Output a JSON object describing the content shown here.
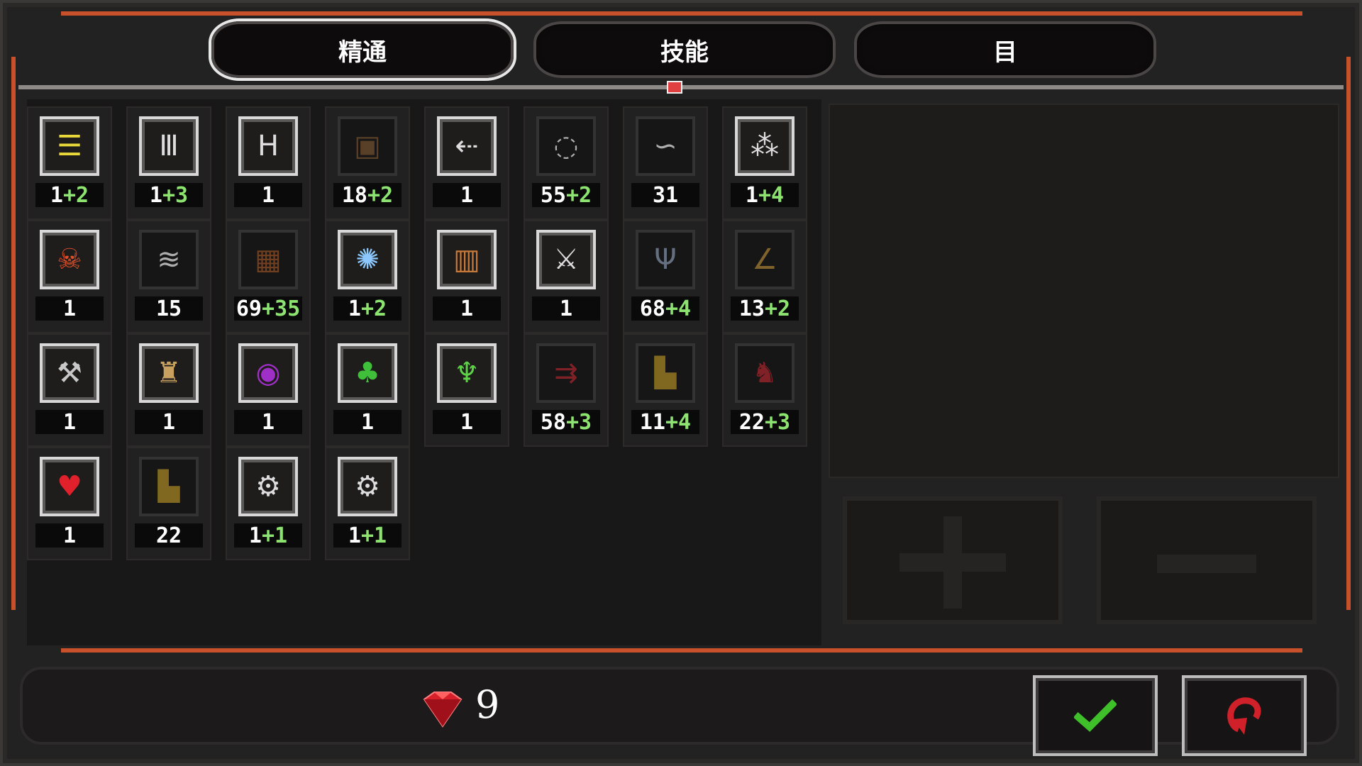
{
  "tabs": [
    {
      "label": "精通",
      "active": true
    },
    {
      "label": "技能",
      "active": false
    },
    {
      "label": "目",
      "active": false
    }
  ],
  "mastery_grid": [
    [
      {
        "icon": "bolts-icon",
        "base": "1",
        "bonus": "+2",
        "lit": true
      },
      {
        "icon": "spikes-icon",
        "base": "1",
        "bonus": "+3",
        "lit": true
      },
      {
        "icon": "ladder-icon",
        "base": "1",
        "bonus": "",
        "lit": true
      },
      {
        "icon": "crate-icon",
        "base": "18",
        "bonus": "+2",
        "lit": false
      },
      {
        "icon": "arrow-trail-icon",
        "base": "1",
        "bonus": "",
        "lit": true
      },
      {
        "icon": "dashed-ring-icon",
        "base": "55",
        "bonus": "+2",
        "lit": false
      },
      {
        "icon": "rope-icon",
        "base": "31",
        "bonus": "",
        "lit": false
      },
      {
        "icon": "stars-icon",
        "base": "1",
        "bonus": "+4",
        "lit": true
      }
    ],
    [
      {
        "icon": "demon-head-icon",
        "base": "1",
        "bonus": "",
        "lit": true
      },
      {
        "icon": "wind-icon",
        "base": "15",
        "bonus": "",
        "lit": false
      },
      {
        "icon": "wood-wall-icon",
        "base": "69",
        "bonus": "+35",
        "lit": false
      },
      {
        "icon": "frost-burst-icon",
        "base": "1",
        "bonus": "+2",
        "lit": true
      },
      {
        "icon": "totem-icon",
        "base": "1",
        "bonus": "",
        "lit": true
      },
      {
        "icon": "sword-icon",
        "base": "1",
        "bonus": "",
        "lit": true
      },
      {
        "icon": "dead-tree-icon",
        "base": "68",
        "bonus": "+4",
        "lit": false
      },
      {
        "icon": "boomerang-icon",
        "base": "13",
        "bonus": "+2",
        "lit": false
      }
    ],
    [
      {
        "icon": "axe-icon",
        "base": "1",
        "bonus": "",
        "lit": true
      },
      {
        "icon": "warrior-icon",
        "base": "1",
        "bonus": "",
        "lit": true
      },
      {
        "icon": "void-eye-icon",
        "base": "1",
        "bonus": "",
        "lit": true
      },
      {
        "icon": "frog-icon",
        "base": "1",
        "bonus": "",
        "lit": true
      },
      {
        "icon": "horned-mask-icon",
        "base": "1",
        "bonus": "",
        "lit": true
      },
      {
        "icon": "blood-arrows-icon",
        "base": "58",
        "bonus": "+3",
        "lit": false
      },
      {
        "icon": "gold-stacks-icon",
        "base": "11",
        "bonus": "+4",
        "lit": false
      },
      {
        "icon": "red-figure-icon",
        "base": "22",
        "bonus": "+3",
        "lit": false
      }
    ],
    [
      {
        "icon": "heart-icon",
        "base": "1",
        "bonus": "",
        "lit": true
      },
      {
        "icon": "gold-stacks-icon",
        "base": "22",
        "bonus": "",
        "lit": false
      },
      {
        "icon": "gear-icon",
        "base": "1",
        "bonus": "+1",
        "lit": true
      },
      {
        "icon": "gear-icon",
        "base": "1",
        "bonus": "+1",
        "lit": true
      }
    ]
  ],
  "gems": "9",
  "colors": {
    "accent": "#c8502a",
    "bonus": "#8de36f",
    "gem": "#e0202a",
    "confirm": "#3fbf2a",
    "undo": "#d0202a"
  }
}
